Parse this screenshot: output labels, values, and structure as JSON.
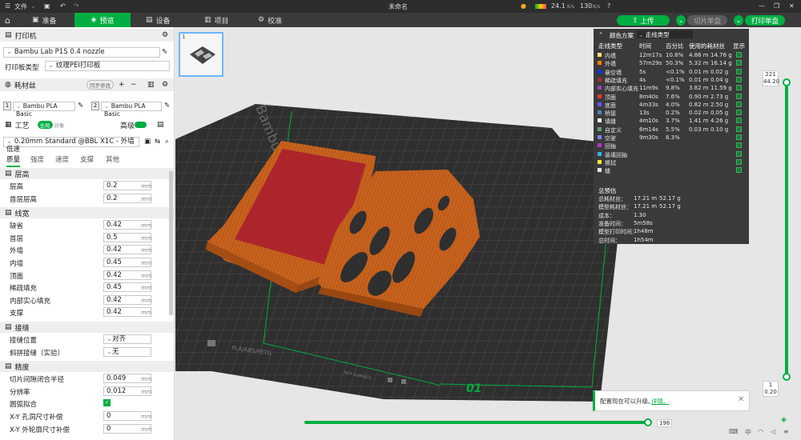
{
  "titlebar": {
    "menu_label": "文件",
    "doc_title": "未命名",
    "speed_down": "24.1",
    "speed_up": "130",
    "speed_unit": "K/s"
  },
  "tabs": [
    {
      "label": "准备"
    },
    {
      "label": "预览"
    },
    {
      "label": "设备"
    },
    {
      "label": "项目"
    },
    {
      "label": "校准"
    }
  ],
  "actions": {
    "upload": "上传",
    "slice_plate": "切片单盘",
    "print_plate": "打印单盘"
  },
  "left": {
    "printer_section": "打印机",
    "printer_name": "Bambu Lab P1S 0.4 nozzle",
    "plate_type_label": "打印板类型",
    "plate_type_value": "纹理PEI打印板",
    "filament_section": "耗材丝",
    "filament_sync": "同步修改",
    "filaments": [
      {
        "num": "1",
        "name": "Bambu PLA Basic"
      },
      {
        "num": "2",
        "name": "Bambu PLA Basic"
      }
    ],
    "process_section": "工艺",
    "process_global": "全局",
    "process_object": "对象",
    "advanced_label": "高级",
    "process_preset": "0.20mm Standard @BBL X1C - 外墙低速",
    "subtabs": [
      "质量",
      "强度",
      "速度",
      "支撑",
      "其他"
    ],
    "groups": [
      {
        "title": "层高",
        "rows": [
          {
            "label": "层高",
            "value": "0.2",
            "unit": "mm"
          },
          {
            "label": "首层层高",
            "value": "0.2",
            "unit": "mm"
          }
        ]
      },
      {
        "title": "线宽",
        "rows": [
          {
            "label": "缺省",
            "value": "0.42",
            "unit": "mm"
          },
          {
            "label": "首层",
            "value": "0.5",
            "unit": "mm"
          },
          {
            "label": "外墙",
            "value": "0.42",
            "unit": "mm"
          },
          {
            "label": "内墙",
            "value": "0.45",
            "unit": "mm"
          },
          {
            "label": "顶面",
            "value": "0.42",
            "unit": "mm"
          },
          {
            "label": "稀疏填充",
            "value": "0.45",
            "unit": "mm"
          },
          {
            "label": "内部实心填充",
            "value": "0.42",
            "unit": "mm"
          },
          {
            "label": "支撑",
            "value": "0.42",
            "unit": "mm"
          }
        ]
      },
      {
        "title": "接缝",
        "rows": [
          {
            "label": "接缝位置",
            "value": "对齐",
            "unit": ""
          },
          {
            "label": "斜拼接缝（实验）",
            "value": "无",
            "unit": ""
          }
        ]
      },
      {
        "title": "精度",
        "rows": [
          {
            "label": "切片间隙闭合半径",
            "value": "0.049",
            "unit": "mm"
          },
          {
            "label": "分辨率",
            "value": "0.012",
            "unit": "mm"
          },
          {
            "label": "圆弧拟合",
            "value": "",
            "unit": ""
          },
          {
            "label": "X-Y 孔洞尺寸补偿",
            "value": "0",
            "unit": "mm"
          },
          {
            "label": "X-Y 外轮廓尺寸补偿",
            "value": "0",
            "unit": "mm"
          }
        ]
      }
    ]
  },
  "viewport": {
    "plate_thumb_num": "1",
    "bed_text": "Bambu Textured PEI Plate",
    "bed_bottom_text": "PLA/ABS/PETG",
    "bed_warning": "NOT SURFACE",
    "plate_number": "01",
    "layer_top_num": "221",
    "layer_top_height": "44.20",
    "layer_bottom_num": "1",
    "layer_bottom_height": "0.20",
    "hslider_value": "196",
    "notification_text": "配置现在可以升级。",
    "notification_link": "详情。"
  },
  "stats": {
    "scheme_label": "颜色方案",
    "scheme_value": "走线类型",
    "columns": [
      "走线类型",
      "时间",
      "百分比",
      "使用的耗材丝",
      "显示"
    ],
    "rows": [
      {
        "name": "内墙",
        "color": "#ffe680",
        "time": "12m17s",
        "pct": "10.8%",
        "len": "4.86 m",
        "wt": "14.76 g"
      },
      {
        "name": "外墙",
        "color": "#ff8000",
        "time": "57m29s",
        "pct": "50.3%",
        "len": "5.32 m",
        "wt": "16.14 g"
      },
      {
        "name": "悬空墙",
        "color": "#0033ff",
        "time": "5s",
        "pct": "<0.1%",
        "len": "0.01 m",
        "wt": "0.02 g"
      },
      {
        "name": "稀疏填充",
        "color": "#b3262d",
        "time": "4s",
        "pct": "<0.1%",
        "len": "0.01 m",
        "wt": "0.04 g"
      },
      {
        "name": "内部实心填充",
        "color": "#9c3dbf",
        "time": "11m9s",
        "pct": "9.8%",
        "len": "3.82 m",
        "wt": "11.59 g"
      },
      {
        "name": "顶面",
        "color": "#ff3333",
        "time": "8m40s",
        "pct": "7.6%",
        "len": "0.90 m",
        "wt": "2.73 g"
      },
      {
        "name": "底面",
        "color": "#6655ff",
        "time": "4m33s",
        "pct": "4.0%",
        "len": "0.82 m",
        "wt": "2.50 g"
      },
      {
        "name": "桥接",
        "color": "#4d80bb",
        "time": "13s",
        "pct": "0.2%",
        "len": "0.02 m",
        "wt": "0.05 g"
      },
      {
        "name": "填缝",
        "color": "#ffffff",
        "time": "4m10s",
        "pct": "3.7%",
        "len": "1.41 m",
        "wt": "4.26 g"
      },
      {
        "name": "自定义",
        "color": "#5ea080",
        "time": "6m14s",
        "pct": "5.5%",
        "len": "0.03 m",
        "wt": "0.10 g"
      },
      {
        "name": "空驶",
        "color": "#8080ff",
        "time": "9m30s",
        "pct": "8.3%",
        "len": "",
        "wt": ""
      },
      {
        "name": "回抽",
        "color": "#b833cc",
        "time": "",
        "pct": "",
        "len": "",
        "wt": ""
      },
      {
        "name": "装填回抽",
        "color": "#33b3ff",
        "time": "",
        "pct": "",
        "len": "",
        "wt": ""
      },
      {
        "name": "擦拭",
        "color": "#ffe633",
        "time": "",
        "pct": "",
        "len": "",
        "wt": ""
      },
      {
        "name": "缝",
        "color": "#e6e6e6",
        "time": "",
        "pct": "",
        "len": "",
        "wt": ""
      }
    ],
    "summary_title": "总预估",
    "summary": [
      {
        "label": "总耗材丝：",
        "v1": "17.21 m",
        "v2": "52.17 g"
      },
      {
        "label": "模型耗材丝：",
        "v1": "17.21 m",
        "v2": "52.17 g"
      },
      {
        "label": "成本：",
        "v1": "1.30",
        "v2": ""
      },
      {
        "label": "准备时间：",
        "v1": "5m58s",
        "v2": ""
      },
      {
        "label": "模型打印时间：",
        "v1": "1h48m",
        "v2": ""
      },
      {
        "label": "总时间：",
        "v1": "1h54m",
        "v2": ""
      }
    ]
  },
  "colors": {
    "accent": "#00ae42",
    "model_orange": "#c8621e",
    "model_red": "#b3262d",
    "bed": "#3a3a3a"
  }
}
